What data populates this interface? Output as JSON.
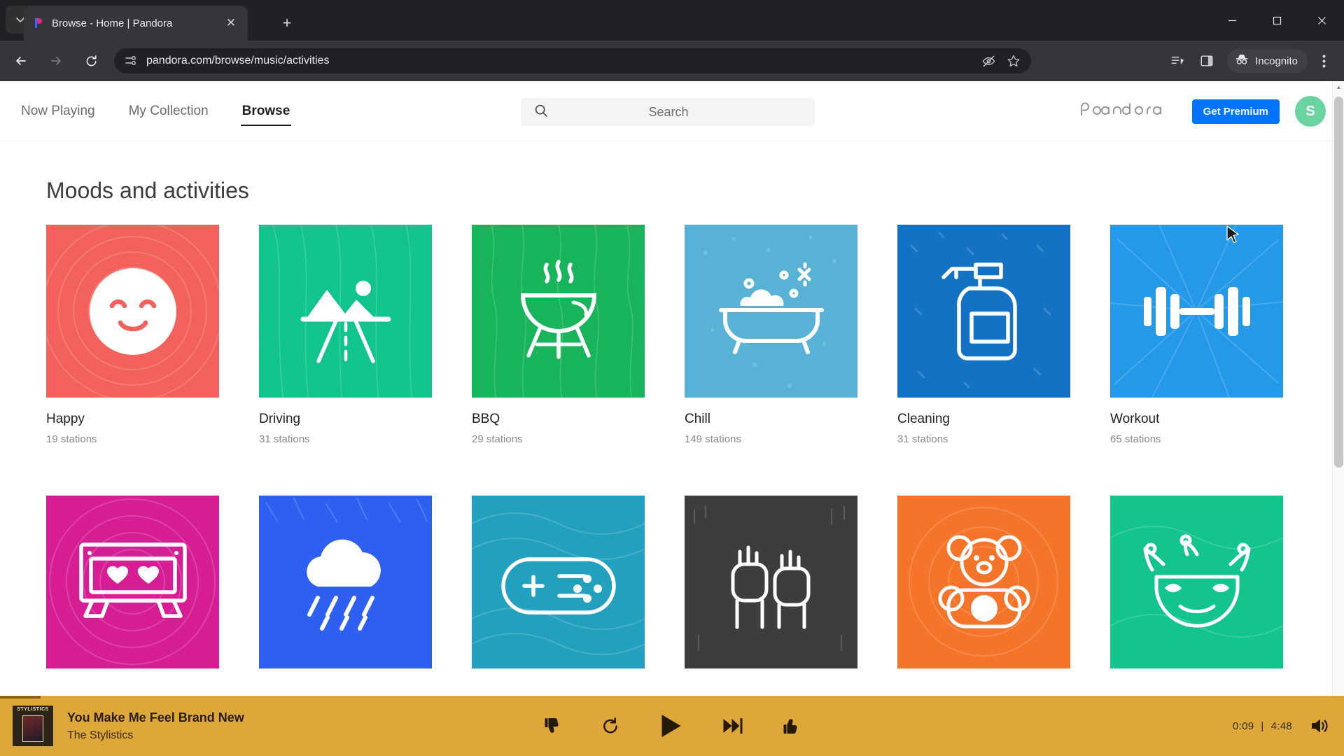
{
  "browser": {
    "tab": {
      "title": "Browse - Home | Pandora",
      "favicon": "pandora-icon",
      "close": "close-icon"
    },
    "tab_search": "tab-search-icon",
    "new_tab": "+",
    "window": {
      "minimize": "minimize-icon",
      "maximize": "maximize-icon",
      "close": "close-icon"
    },
    "toolbar": {
      "back": "back-arrow-icon",
      "forward": "forward-arrow-icon",
      "reload": "reload-icon",
      "site_info": "site-settings-icon",
      "url": "pandora.com/browse/music/activities",
      "tracking_protection": "eye-off-icon",
      "bookmark": "star-icon",
      "reading_list": "reading-list-icon",
      "side_panel": "side-panel-icon",
      "incognito_label": "Incognito",
      "incognito_icon": "incognito-icon",
      "menu": "three-dot-menu-icon"
    }
  },
  "header": {
    "nav": [
      {
        "label": "Now Playing",
        "active": false
      },
      {
        "label": "My Collection",
        "active": false
      },
      {
        "label": "Browse",
        "active": true
      }
    ],
    "search": {
      "placeholder": "Search",
      "icon": "search-icon"
    },
    "logo": "pandora",
    "premium_button": "Get Premium",
    "premium_color": "#0073ff",
    "avatar_letter": "S",
    "avatar_color": "#6ad4a0"
  },
  "main": {
    "section_title": "Moods and activities",
    "tiles": [
      {
        "name": "Happy",
        "count": "19 stations",
        "icon": "smiley-face-icon",
        "color": "#f2615c"
      },
      {
        "name": "Driving",
        "count": "31 stations",
        "icon": "mountain-road-icon",
        "color": "#11c48e"
      },
      {
        "name": "BBQ",
        "count": "29 stations",
        "icon": "grill-icon",
        "color": "#18b45b"
      },
      {
        "name": "Chill",
        "count": "149 stations",
        "icon": "bathtub-icon",
        "color": "#57b2d6"
      },
      {
        "name": "Cleaning",
        "count": "31 stations",
        "icon": "spray-bottle-icon",
        "color": "#1472c4"
      },
      {
        "name": "Workout",
        "count": "65 stations",
        "icon": "dumbbell-icon",
        "color": "#2499e8"
      },
      {
        "name": "",
        "count": "",
        "icon": "cassette-tape-icon",
        "color": "#d61d93"
      },
      {
        "name": "",
        "count": "",
        "icon": "rain-cloud-icon",
        "color": "#2f5ff0"
      },
      {
        "name": "",
        "count": "",
        "icon": "gamepad-icon",
        "color": "#23a0bd"
      },
      {
        "name": "",
        "count": "",
        "icon": "raised-fists-icon",
        "color": "#3d3d3d"
      },
      {
        "name": "",
        "count": "",
        "icon": "teddy-bear-icon",
        "color": "#f4742a"
      },
      {
        "name": "",
        "count": "",
        "icon": "jester-mask-icon",
        "color": "#14c48d"
      }
    ]
  },
  "player": {
    "track_title": "You Make Me Feel Brand New",
    "artist": "The Stylistics",
    "album_art_label": "STYLISTICS",
    "elapsed": "0:09",
    "separator": "|",
    "duration": "4:48",
    "bar_color": "#dda739",
    "controls": [
      {
        "name": "thumbs-down-button",
        "icon": "thumbs-down-icon"
      },
      {
        "name": "replay-button",
        "icon": "replay-icon"
      },
      {
        "name": "play-button",
        "icon": "play-icon"
      },
      {
        "name": "skip-next-button",
        "icon": "skip-next-icon"
      },
      {
        "name": "thumbs-up-button",
        "icon": "thumbs-up-icon"
      }
    ],
    "volume_icon": "volume-icon"
  }
}
